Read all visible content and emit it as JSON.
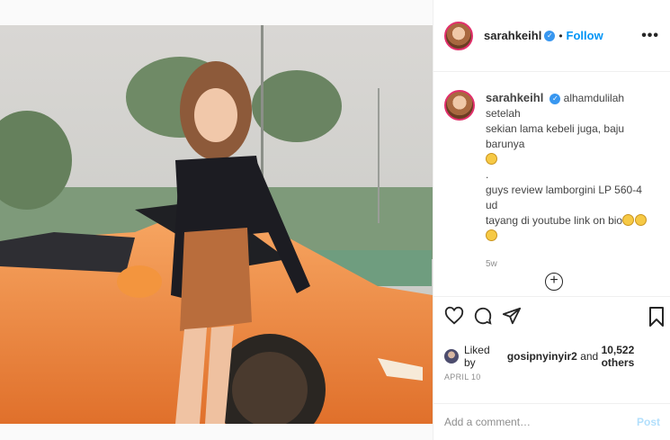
{
  "post": {
    "username": "sarahkeihl",
    "follow_label": "Follow",
    "separator": "•",
    "more_label": "•••",
    "caption": {
      "line1": "alhamdulilah setelah",
      "line2": "sekian lama kebeli juga, baju barunya",
      "line3": ".",
      "line4": "guys review lamborgini LP 560-4 ud",
      "line5": "tayang di youtube link on bio"
    },
    "time_ago": "5w",
    "likes": {
      "prefix": "Liked by",
      "user": "gosipnyinyir2",
      "joiner": "and",
      "others": "10,522 others"
    },
    "date": "APRIL 10",
    "comment": {
      "placeholder": "Add a comment…",
      "post_label": "Post"
    }
  },
  "icons": [
    "verified-badge-icon",
    "heart-icon",
    "comment-icon",
    "share-icon",
    "bookmark-icon",
    "plus-circle-icon"
  ],
  "colors": {
    "accent": "#0095f6",
    "verified": "#3897f0",
    "car": "#f08a3c"
  }
}
